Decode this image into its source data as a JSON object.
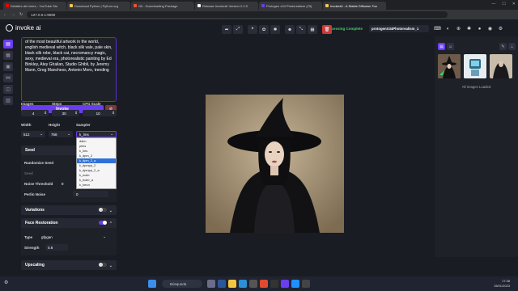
{
  "browser": {
    "tabs": [
      {
        "title": "Detalles del vídeo - YouTube Stu",
        "color": "#ff0000"
      },
      {
        "title": "Download Python | Python.org",
        "color": "#f2c94c"
      },
      {
        "title": "Git - Downloading Package",
        "color": "#f05133"
      },
      {
        "title": "Release InvokeAI Version 2.2.5",
        "color": "#ffffff"
      },
      {
        "title": "Protogen x34 Photorealism (Of)",
        "color": "#6a3df0"
      },
      {
        "title": "InvokeAI - A Stable Diffusion Too",
        "color": "#f2c94c"
      }
    ],
    "url": "127.0.0.1:9090"
  },
  "app": {
    "logo_text": "invoke ai",
    "status": "Processing Complete",
    "model": "protogenX34Photorealism_1"
  },
  "prompt_text": "of the most beautiful artwork in the world, english medieval witch, black silk vale, pale skin, black silk robe, black cat, necromancy magic, sexy, medieval era, photorealistic painting by Ed Binkley, Atey Ghailan, Studio Ghibli, by Jeremy Mann, Greg Manchess, Antonio Moro, trending",
  "invoke_label": "Invoke",
  "params": {
    "images_label": "Images",
    "images_value": "4",
    "steps_label": "Steps",
    "steps_value": "30",
    "cfg_label": "CFG Scale",
    "cfg_value": "10",
    "width_label": "Width",
    "width_value": "512",
    "height_label": "Height",
    "height_value": "768",
    "sampler_label": "Sampler",
    "sampler_value": "k_lms"
  },
  "sampler_options": [
    "ddim",
    "plms",
    "k_lms",
    "k_dpm_2",
    "k_dpm_2_a",
    "k_dpmpp_2",
    "k_dpmpp_2_a",
    "k_euler",
    "k_euler_a",
    "k_heun"
  ],
  "sampler_highlight": "k_dpm_2_a",
  "seed": {
    "title": "Seed",
    "randomize_label": "Randomize Seed",
    "seed_label": "Seed",
    "noise_threshold_label": "Noise Threshold",
    "noise_threshold_value": "0",
    "perlin_label": "Perlin Noise",
    "perlin_value": "0"
  },
  "variations_label": "Variations",
  "face_restoration": {
    "title": "Face Restoration",
    "type_label": "Type",
    "type_value": "gfpgan",
    "strength_label": "Strength",
    "strength_value": "0.8"
  },
  "upscaling_label": "Upscaling",
  "gallery": {
    "loaded_text": "All Images Loaded"
  },
  "taskbar": {
    "search_placeholder": "Búsqueda",
    "time": "17:38",
    "date": "15/01/2023"
  }
}
